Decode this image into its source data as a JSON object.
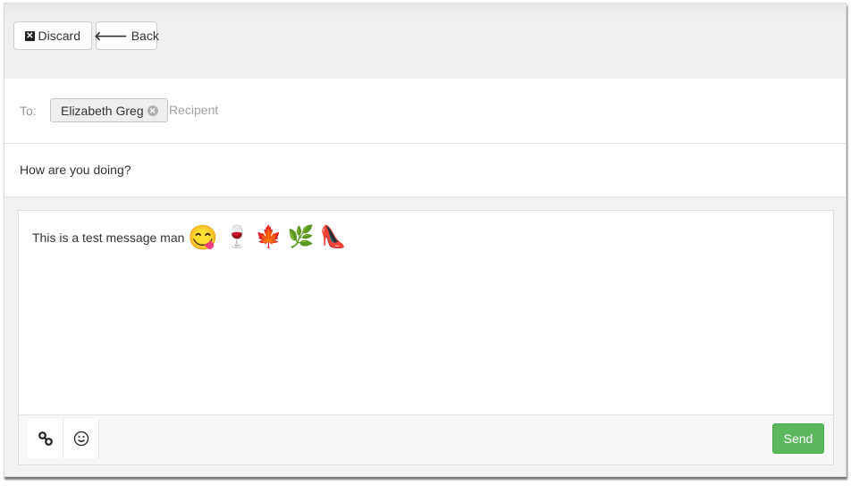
{
  "toolbar": {
    "discard_label": "Discard",
    "discard_icon": "remove-sign-icon",
    "back_label": "Back",
    "back_icon": "arrow-left-icon"
  },
  "to_field": {
    "label": "To:",
    "recipients": [
      {
        "name": "Elizabeth Greg",
        "remove_icon": "remove-circle-icon"
      }
    ],
    "placeholder": "Recipent",
    "value": ""
  },
  "subject": {
    "value": "How are you doing?"
  },
  "editor": {
    "text": "This is a test message man",
    "emojis": [
      {
        "name": "face-savoring-food",
        "glyph": "😋"
      },
      {
        "name": "wine-glass",
        "glyph": "🍷"
      },
      {
        "name": "maple-leaf",
        "glyph": "🍁"
      },
      {
        "name": "herb",
        "glyph": "🌿"
      },
      {
        "name": "high-heeled-shoe",
        "glyph": "👠"
      }
    ]
  },
  "editor_toolbar": {
    "link_icon": "link-icon",
    "emoji_icon": "smiley-icon",
    "send_label": "Send",
    "send_color": "#5cb85c"
  }
}
